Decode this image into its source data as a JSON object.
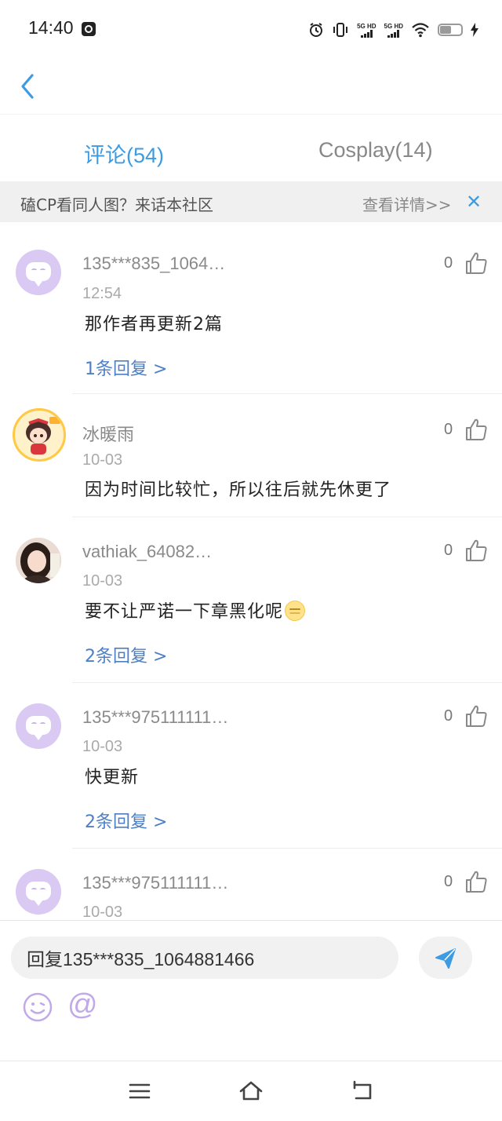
{
  "status_bar": {
    "time": "14:40",
    "network_1": "5G HD",
    "network_2": "5G HD",
    "battery_level": 0.5
  },
  "tabs": [
    {
      "label": "评论(54)",
      "active": true
    },
    {
      "label": "Cosplay(14)",
      "active": false
    }
  ],
  "banner": {
    "text": "磕CP看同人图？来话本社区",
    "link": "查看详情>>",
    "close": "✕"
  },
  "comments": [
    {
      "username": "135***835_1064…",
      "time": "12:54",
      "content": "那作者再更新2篇",
      "replies": "1条回复 >",
      "likes": "0",
      "avatar": "default-avatar"
    },
    {
      "username": "冰暖雨",
      "time": "10-03",
      "content": "因为时间比较忙，所以往后就先休更了",
      "replies": "",
      "likes": "0",
      "avatar": "anime-girl-avatar"
    },
    {
      "username": "vathiak_64082…",
      "time": "10-03",
      "content": "要不让严诺一下章黑化呢",
      "replies": "2条回复 >",
      "likes": "0",
      "avatar": "photo-avatar"
    },
    {
      "username": "135***975111111…",
      "time": "10-03",
      "content": "快更新",
      "replies": "2条回复 >",
      "likes": "0",
      "avatar": "default-avatar"
    },
    {
      "username": "135***975111111…",
      "time": "10-03",
      "content": "",
      "replies": "",
      "likes": "0",
      "avatar": "default-avatar"
    }
  ],
  "reply_bar": {
    "input_value": "回复135***835_1064881466",
    "at_symbol": "@"
  },
  "colors": {
    "accent": "#3d9be2",
    "reply_link": "#4d7fc5",
    "avatar_bg": "#d9c9f3"
  }
}
